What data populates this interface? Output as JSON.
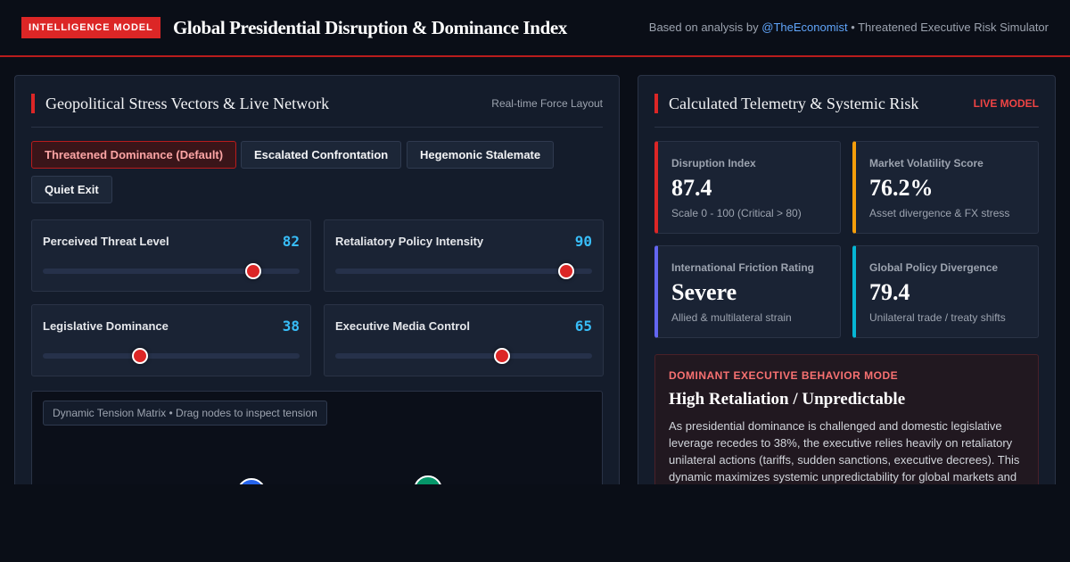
{
  "header": {
    "badge": "INTELLIGENCE MODEL",
    "title": "Global Presidential Disruption & Dominance Index",
    "attribution_prefix": "Based on analysis by",
    "attribution_handle": "@TheEconomist",
    "attribution_suffix": "• Threatened Executive Risk Simulator"
  },
  "left_panel": {
    "title": "Geopolitical Stress Vectors & Live Network",
    "meta": "Real-time Force Layout",
    "scenarios": [
      {
        "label": "Threatened Dominance (Default)",
        "active": true
      },
      {
        "label": "Escalated Confrontation",
        "active": false
      },
      {
        "label": "Hegemonic Stalemate",
        "active": false
      },
      {
        "label": "Quiet Exit",
        "active": false
      }
    ],
    "sliders": [
      {
        "label": "Perceived Threat Level",
        "value": 82
      },
      {
        "label": "Retaliatory Policy Intensity",
        "value": 90
      },
      {
        "label": "Legislative Dominance",
        "value": 38
      },
      {
        "label": "Executive Media Control",
        "value": 65
      }
    ],
    "matrix_caption": "Dynamic Tension Matrix • Drag nodes to inspect tension"
  },
  "right_panel": {
    "title": "Calculated Telemetry & Systemic Risk",
    "meta": "LIVE MODEL",
    "metrics": [
      {
        "label": "Disruption Index",
        "value": "87.4",
        "sub": "Scale 0 - 100 (Critical > 80)",
        "accent": "#dc2626"
      },
      {
        "label": "Market Volatility Score",
        "value": "76.2%",
        "sub": "Asset divergence & FX stress",
        "accent": "#f59e0b"
      },
      {
        "label": "International Friction Rating",
        "value": "Severe",
        "sub": "Allied & multilateral strain",
        "accent": "#6366f1"
      },
      {
        "label": "Global Policy Divergence",
        "value": "79.4",
        "sub": "Unilateral trade / treaty shifts",
        "accent": "#06b6d4"
      }
    ],
    "mode": {
      "label": "DOMINANT EXECUTIVE BEHAVIOR MODE",
      "title": "High Retaliation / Unpredictable",
      "description": "As presidential dominance is challenged and domestic legislative leverage recedes to 38%, the executive relies heavily on retaliatory unilateral actions (tariffs, sudden sanctions, executive decrees). This dynamic maximizes systemic unpredictability for global markets and"
    }
  },
  "colors": {
    "accent_red": "#dc2626",
    "link_blue": "#60a5fa",
    "value_cyan": "#38bdf8",
    "node_blue": "#2563eb",
    "node_green": "#059669"
  }
}
